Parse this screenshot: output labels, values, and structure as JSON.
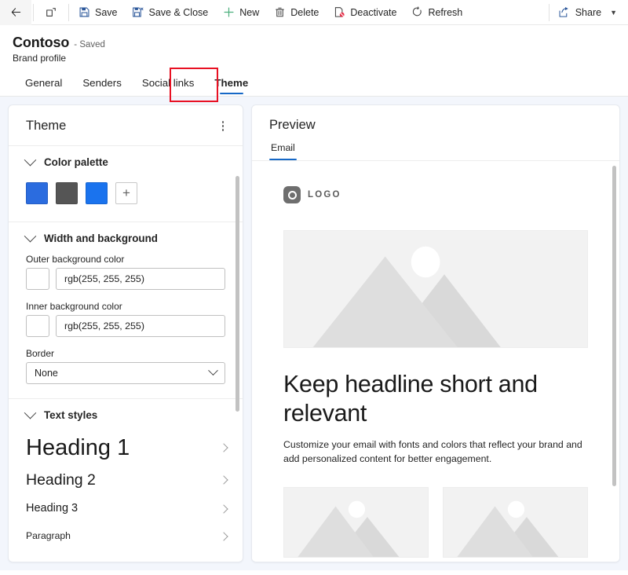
{
  "commandbar": {
    "back_label": "Back",
    "popout_label": "Open in new window",
    "items": [
      {
        "id": "save",
        "label": "Save",
        "icon": "save-icon"
      },
      {
        "id": "save-close",
        "label": "Save & Close",
        "icon": "save-and-close-icon"
      },
      {
        "id": "new",
        "label": "New",
        "icon": "plus-icon"
      },
      {
        "id": "delete",
        "label": "Delete",
        "icon": "trash-icon"
      },
      {
        "id": "deactivate",
        "label": "Deactivate",
        "icon": "deactivate-icon"
      },
      {
        "id": "refresh",
        "label": "Refresh",
        "icon": "refresh-icon"
      }
    ],
    "share_label": "Share"
  },
  "header": {
    "entity_name": "Contoso",
    "save_state": "- Saved",
    "entity_type": "Brand profile"
  },
  "tabs": [
    {
      "label": "General",
      "active": false
    },
    {
      "label": "Senders",
      "active": false
    },
    {
      "label": "Social links",
      "active": false
    },
    {
      "label": "Theme",
      "active": true
    }
  ],
  "annotation": {
    "color": "#e81123",
    "target": "Theme tab"
  },
  "theme_panel": {
    "title": "Theme",
    "more_options_label": "More options",
    "color_palette": {
      "label": "Color palette",
      "swatches": [
        "#2b6cdf",
        "#555555",
        "#1a73ee"
      ],
      "add_label": "+"
    },
    "width_background": {
      "label": "Width and background",
      "outer_background": {
        "label": "Outer background color",
        "value": "rgb(255, 255, 255)",
        "swatch": "#ffffff"
      },
      "inner_background": {
        "label": "Inner background color",
        "value": "rgb(255, 255, 255)",
        "swatch": "#ffffff"
      },
      "border": {
        "label": "Border",
        "value": "None"
      }
    },
    "text_styles": {
      "label": "Text styles",
      "items": [
        {
          "label": "Heading 1"
        },
        {
          "label": "Heading 2"
        },
        {
          "label": "Heading 3"
        },
        {
          "label": "Paragraph"
        }
      ]
    }
  },
  "preview_panel": {
    "title": "Preview",
    "tabs": [
      {
        "label": "Email",
        "active": true
      }
    ],
    "email": {
      "logo_text": "LOGO",
      "hero_alt": "placeholder-image",
      "headline": "Keep headline short and relevant",
      "body": "Customize your email with fonts and colors that reflect your brand and add personalized content for better engagement."
    }
  },
  "colors": {
    "accent": "#1668c6",
    "workspace_bg": "#f3f6fc",
    "panel_bg": "#ffffff",
    "annotation": "#e81123"
  }
}
